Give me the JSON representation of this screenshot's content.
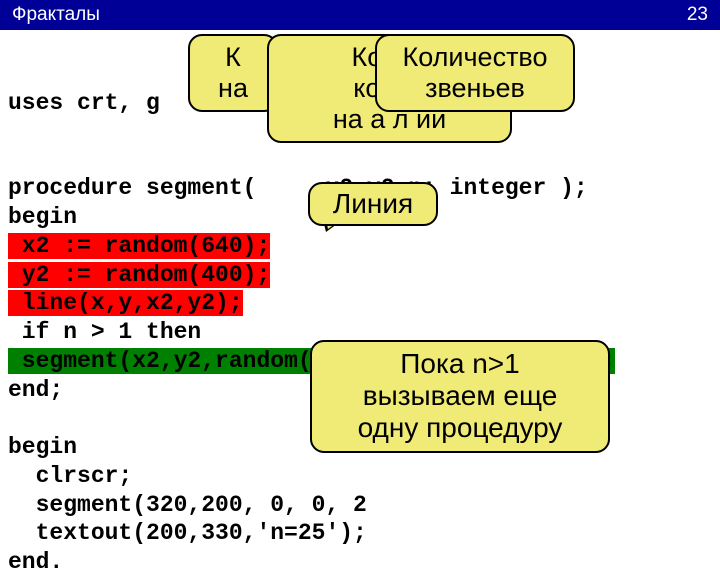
{
  "titlebar": {
    "title": "Фракталы",
    "page": "23"
  },
  "code": {
    "l1": "uses crt, g",
    "l2": "procedure segment(    ,x2,y2,n: integer );",
    "l3": "begin",
    "l4_a": " x2 := random(640);",
    "l5_a": " y2 := random(400);",
    "l6_a": " line(x,y,x2,y2);",
    "l7": " if n > 1 then",
    "l8_a": " segment(x2,y2,random(640),random(400),n-1);",
    "l9": "end;",
    "l10": "begin",
    "l11": "  clrscr;",
    "l12": "  segment(320,200, 0, 0, 2",
    "l13": "  textout(200,330,'n=25');",
    "l14": "end."
  },
  "bubbles": {
    "b1_l1": "К",
    "b1_l2": "на",
    "b2_l1": "Коорд",
    "b2_l2": "конца",
    "b2_l3": "на   а л   ии",
    "b3_l1": "Количество",
    "b3_l2": "звеньев",
    "b4": "Линия",
    "b5_l1": "Пока n>1",
    "b5_l2": "вызываем еще",
    "b5_l3": "одну процедуру"
  }
}
